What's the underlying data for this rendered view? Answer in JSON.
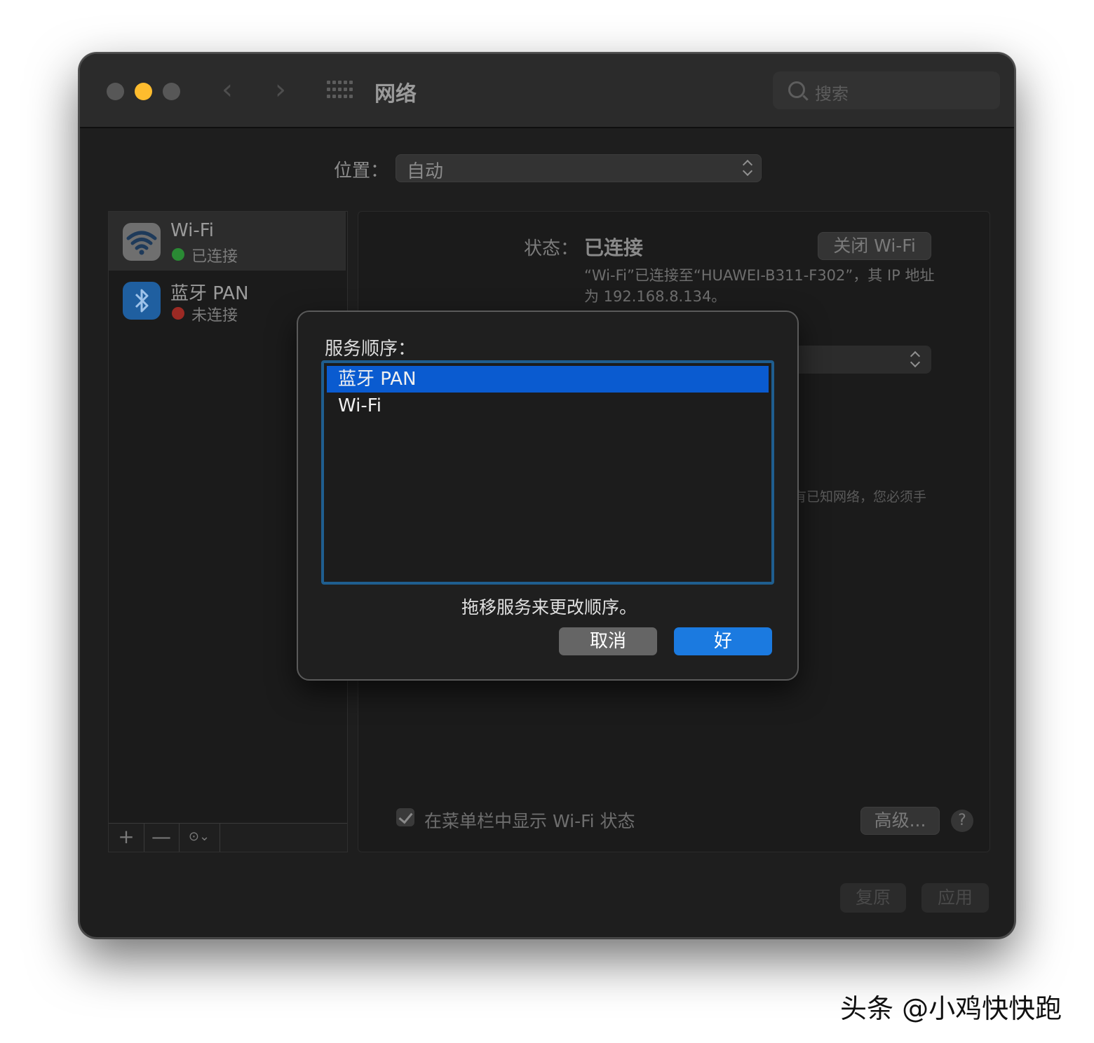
{
  "window": {
    "title": "网络",
    "search_placeholder": "搜索"
  },
  "location": {
    "label": "位置：",
    "value": "自动"
  },
  "services": [
    {
      "name": "Wi-Fi",
      "status": "已连接",
      "status_color": "#2a8a34",
      "icon": "wifi-icon"
    },
    {
      "name": "蓝牙 PAN",
      "status": "未连接",
      "status_color": "#9c2a24",
      "icon": "bluetooth-icon"
    }
  ],
  "sidebar_toolbar": {
    "add": "+",
    "remove": "—",
    "action": "⊙⌄"
  },
  "detail": {
    "status_label": "状态：",
    "status_value": "已连接",
    "turn_off_button": "关闭 Wi-Fi",
    "description": "“Wi-Fi”已连接至“HUAWEI-B311-F302”，其 IP 地址为 192.168.8.134。",
    "partial_hint": "有已知网络，您必须手",
    "show_in_menubar_label": "在菜单栏中显示 Wi-Fi 状态",
    "show_in_menubar_checked": true,
    "advanced_button": "高级...",
    "help_button": "?"
  },
  "footer": {
    "revert_button": "复原",
    "apply_button": "应用"
  },
  "dialog": {
    "title": "服务顺序：",
    "items": [
      "蓝牙 PAN",
      "Wi-Fi"
    ],
    "selected_index": 0,
    "hint": "拖移服务来更改顺序。",
    "cancel_button": "取消",
    "ok_button": "好"
  },
  "watermark": "头条 @小鸡快快跑",
  "colors": {
    "accent": "#1b7ae0",
    "selection": "#0a5bd0",
    "traffic_yellow": "#febc2e"
  }
}
